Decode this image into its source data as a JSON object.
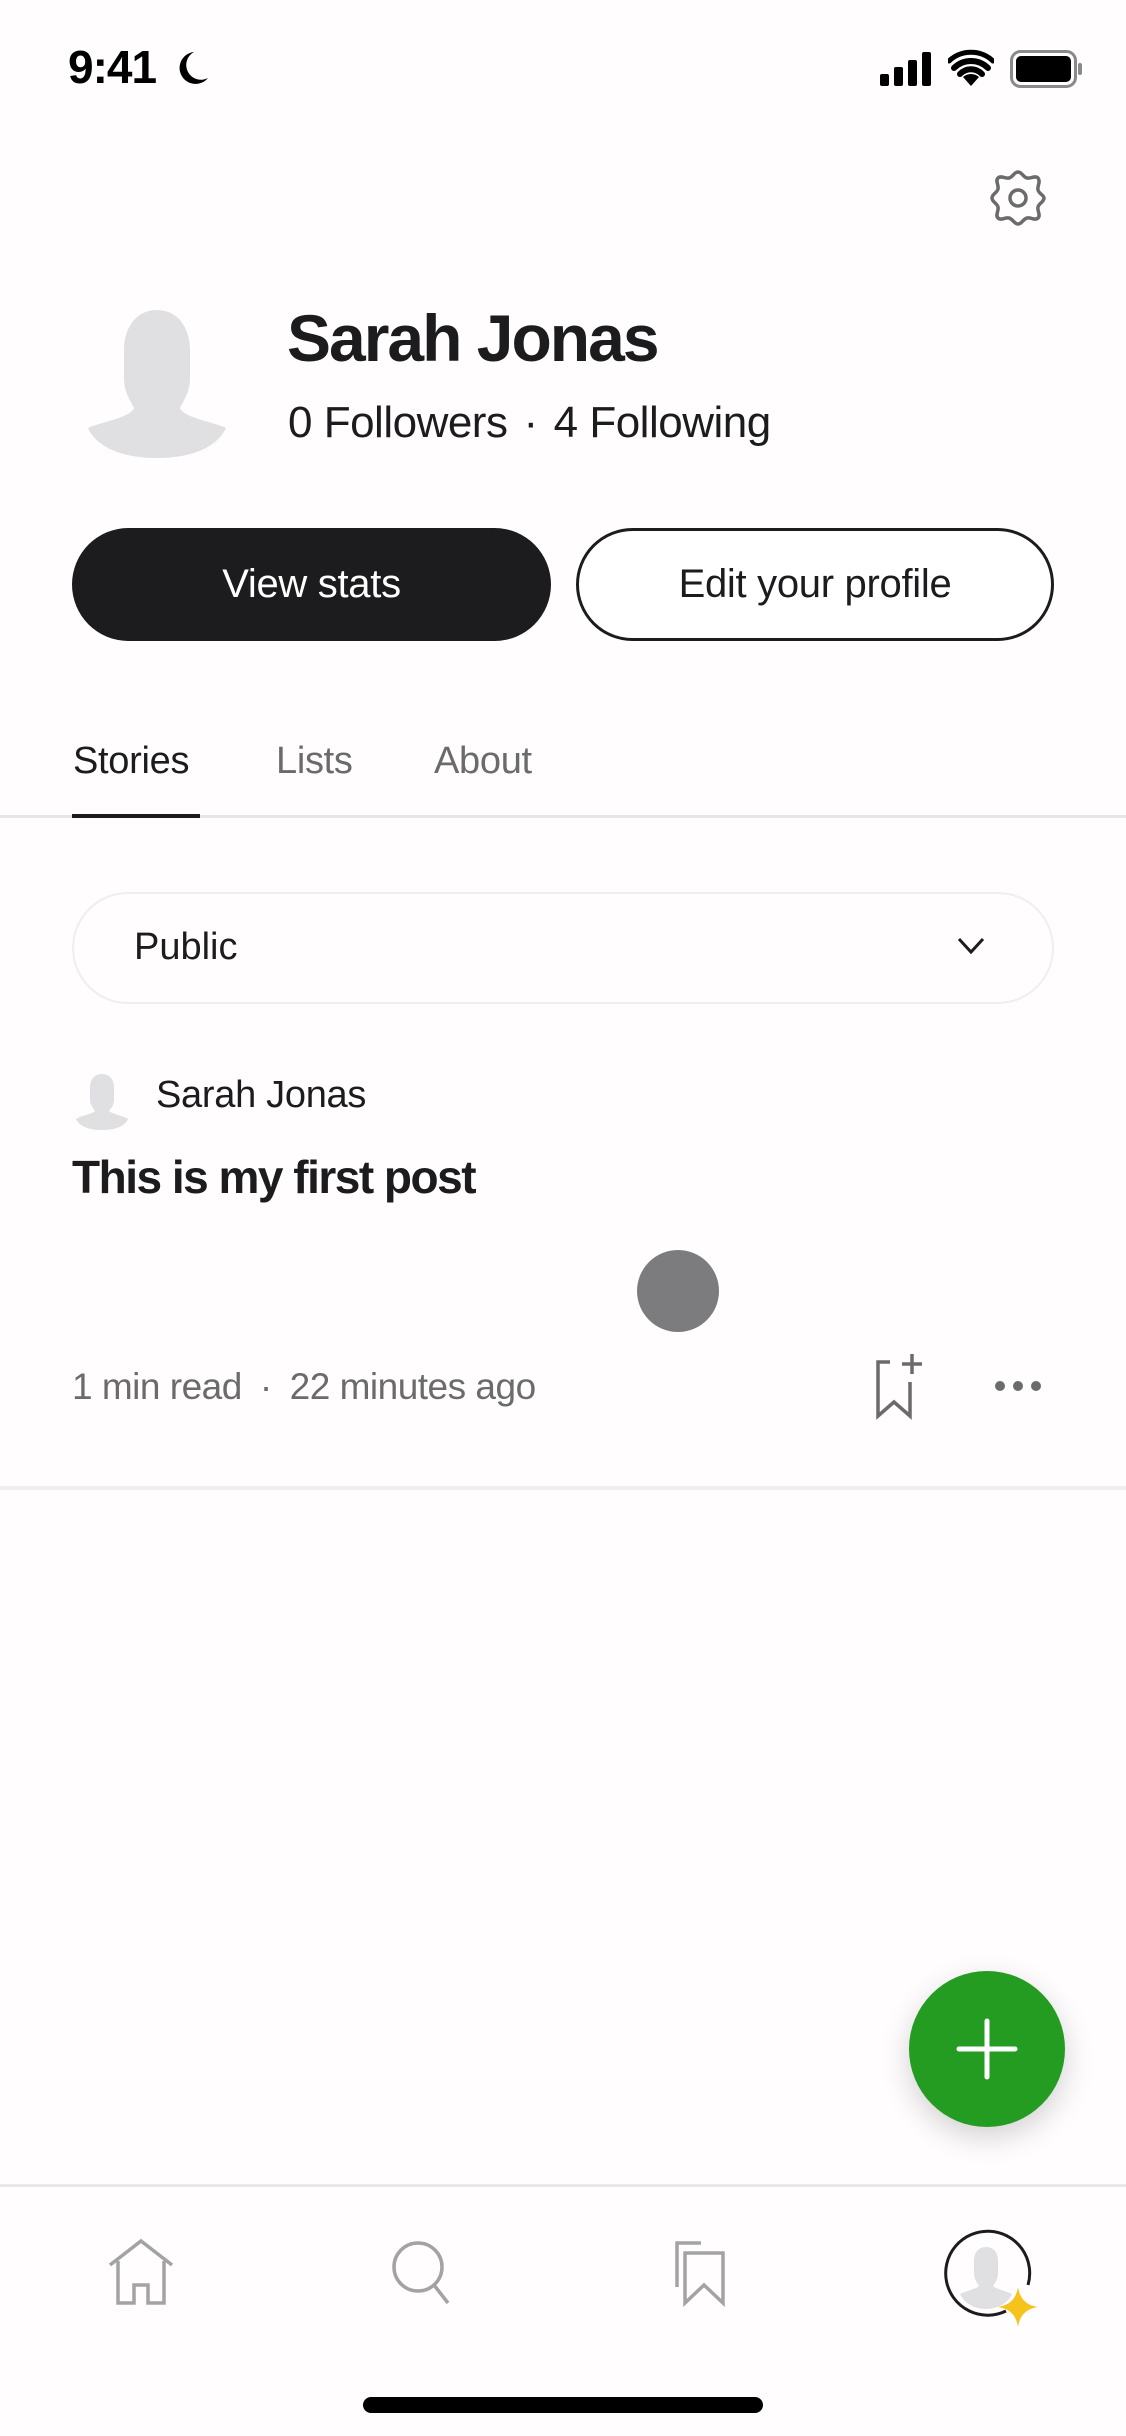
{
  "status_bar": {
    "time": "9:41",
    "icons": [
      "moon-icon",
      "cellular-signal-icon",
      "wifi-icon",
      "battery-icon"
    ]
  },
  "header": {
    "settings_icon": "gear-icon"
  },
  "profile": {
    "name": "Sarah Jonas",
    "followers_label": "0 Followers",
    "separator": "·",
    "following_label": "4 Following",
    "avatar_icon": "default-avatar-icon"
  },
  "actions": {
    "view_stats_label": "View stats",
    "edit_profile_label": "Edit your profile"
  },
  "tabs": [
    {
      "label": "Stories",
      "active": true
    },
    {
      "label": "Lists",
      "active": false
    },
    {
      "label": "About",
      "active": false
    }
  ],
  "filter": {
    "selected": "Public",
    "icon": "chevron-down-icon"
  },
  "stories": [
    {
      "author": "Sarah Jonas",
      "title": "This is my first post",
      "read_time": "1 min read",
      "separator": "·",
      "posted": "22 minutes ago",
      "actions": [
        "bookmark-add-icon",
        "more-horizontal-icon"
      ]
    }
  ],
  "fab": {
    "icon": "plus-icon",
    "color": "#249c22"
  },
  "bottom_nav": [
    {
      "name": "home",
      "icon": "home-icon"
    },
    {
      "name": "search",
      "icon": "search-icon"
    },
    {
      "name": "library",
      "icon": "library-bookmarks-icon"
    },
    {
      "name": "profile",
      "icon": "profile-avatar-icon",
      "badge": "sparkle-icon",
      "active": true
    }
  ],
  "colors": {
    "primary_text": "#1c1b1d",
    "secondary_text": "#6b6b6b",
    "accent_green": "#249c22",
    "member_star": "#f6c21c",
    "avatar_placeholder": "#e0dfe1"
  }
}
